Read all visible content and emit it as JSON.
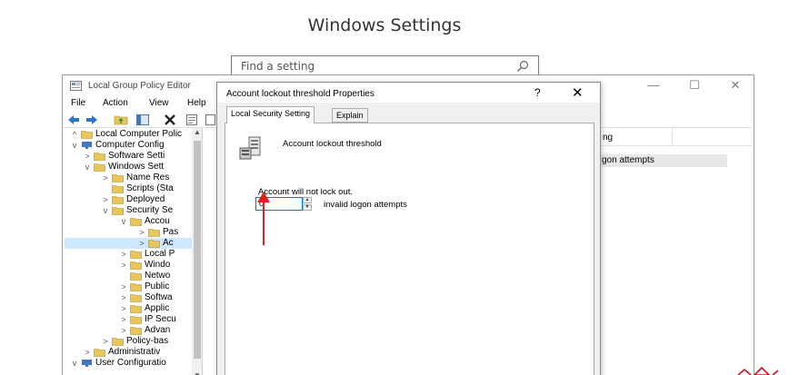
{
  "page": {
    "title": "Windows Settings"
  },
  "search": {
    "placeholder": "Find a setting"
  },
  "gpe": {
    "title": "Local Group Policy Editor",
    "menu": [
      "File",
      "Action",
      "View",
      "Help"
    ],
    "tree": [
      {
        "label": "Local Computer Polic",
        "chevron": "^"
      },
      {
        "label": "Computer Config",
        "chevron": "v"
      },
      {
        "label": "Software Setti",
        "chevron": ">"
      },
      {
        "label": "Windows Sett",
        "chevron": "v"
      },
      {
        "label": "Name Res",
        "chevron": ">"
      },
      {
        "label": "Scripts (Sta",
        "chevron": ""
      },
      {
        "label": "Deployed",
        "chevron": ">"
      },
      {
        "label": "Security Se",
        "chevron": "v"
      },
      {
        "label": "Accou",
        "chevron": "v"
      },
      {
        "label": "Pas",
        "chevron": ">"
      },
      {
        "label": "Ac",
        "chevron": ">"
      },
      {
        "label": "Local P",
        "chevron": ">"
      },
      {
        "label": "Windo",
        "chevron": ">"
      },
      {
        "label": "Netwo",
        "chevron": ""
      },
      {
        "label": "Public",
        "chevron": ">"
      },
      {
        "label": "Softwa",
        "chevron": ">"
      },
      {
        "label": "Applic",
        "chevron": ">"
      },
      {
        "label": "IP Secu",
        "chevron": ">"
      },
      {
        "label": "Advan",
        "chevron": ">"
      },
      {
        "label": "Policy-bas",
        "chevron": ">"
      },
      {
        "label": "Administrativ",
        "chevron": ">"
      },
      {
        "label": "User Configuratio",
        "chevron": "v"
      }
    ],
    "detail_header": "ng",
    "detail_row": "gon attempts"
  },
  "dialog": {
    "title": "Account lockout threshold Properties",
    "help": "?",
    "close": "✕",
    "tabs": [
      "Local Security Setting",
      "Explain"
    ],
    "policy_name": "Account lockout threshold",
    "status_text": "Account will not lock out.",
    "value": "0",
    "unit": "invalid logon attempts"
  },
  "colors": {
    "accent": "#0078d7",
    "annotation": "#e02020",
    "folder": "#e8c65a"
  }
}
